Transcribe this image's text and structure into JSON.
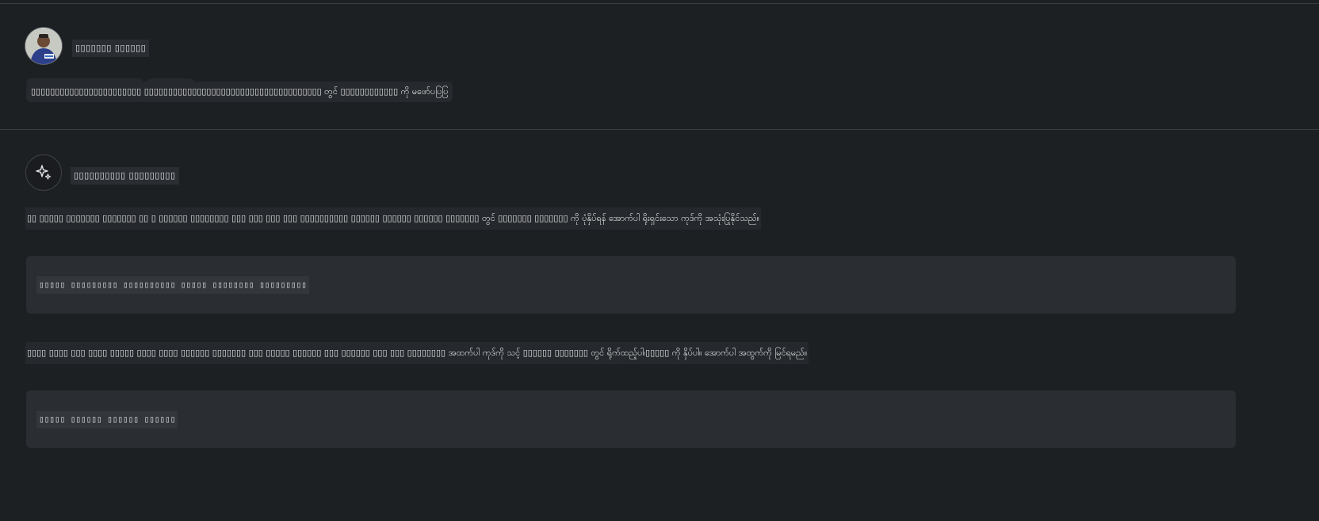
{
  "user": {
    "name": "▯▯▯▯▯▯▯ ▯▯▯▯▯▯",
    "message": "▯▯▯▯▯▯▯▯▯▯▯▯▯▯▯▯▯▯▯▯▯▯▯ ▯▯▯▯▯▯▯▯▯▯▯▯▯▯▯▯▯▯▯▯▯▯▯▯▯▯▯▯▯▯▯▯▯▯▯▯▯ တွင် ▯▯▯▯▯▯▯▯▯▯▯▯ ကို မဖော်ပပြပြ"
  },
  "assistant": {
    "name": "▯▯▯▯▯▯▯▯▯▯ ▯▯▯▯▯▯▯▯▯",
    "paragraph1": "▯▯ ▯▯▯▯▯ ▯▯▯▯▯▯▯ ▯▯▯▯▯▯▯ ▯▯ ▯ ▯▯▯▯▯▯ ▯▯▯▯▯▯▯▯ ▯▯▯ ▯▯▯ ▯▯▯ ▯▯▯ ▯▯▯▯▯▯▯▯▯▯ ▯▯▯▯▯▯ ▯▯▯▯▯▯ ▯▯▯▯▯▯ ▯▯▯▯▯▯▯ တွင် ▯▯▯▯▯▯▯ ▯▯▯▯▯▯▯ ကို ပုံနှိပ်ရန် အောက်ပါ ရိုးရှင်းသော ကုဒ်ကို အသုံးပြုနိုင်သည်။",
    "code1": "▯▯▯▯▯ ▯▯▯▯▯▯▯▯▯ ▯▯▯▯▯▯▯▯▯▯ ▯▯▯▯▯ ▯▯▯▯▯▯▯▯ ▯▯▯▯▯▯▯▯▯",
    "paragraph2": "▯▯▯▯ ▯▯▯▯ ▯▯▯ ▯▯▯▯ ▯▯▯▯▯ ▯▯▯▯ ▯▯▯▯ ▯▯▯▯▯▯ ▯▯▯▯▯▯▯ ▯▯▯ ▯▯▯▯▯ ▯▯▯▯▯▯ ▯▯▯ ▯▯▯▯▯▯ ▯▯▯ ▯▯▯ ▯▯▯▯▯▯▯▯ အထက်ပါ ကုဒ်ကို သင့် ▯▯▯▯▯▯ ▯▯▯▯▯▯▯ တွင် ရိုက်ထည့်ပါ၊▯▯▯▯▯ ကို နှိပ်ပါ။ အောက်ပါ အထွက်ကို မြင်ရမည်။",
    "code2": "▯▯▯▯▯ ▯▯▯▯▯▯ ▯▯▯▯▯▯ ▯▯▯▯▯▯"
  },
  "icons": {
    "user_avatar": "user-avatar-photo",
    "assistant_avatar": "sparkle-icon"
  },
  "colors": {
    "background": "#1d2023",
    "code_background": "#2a2d31"
  }
}
